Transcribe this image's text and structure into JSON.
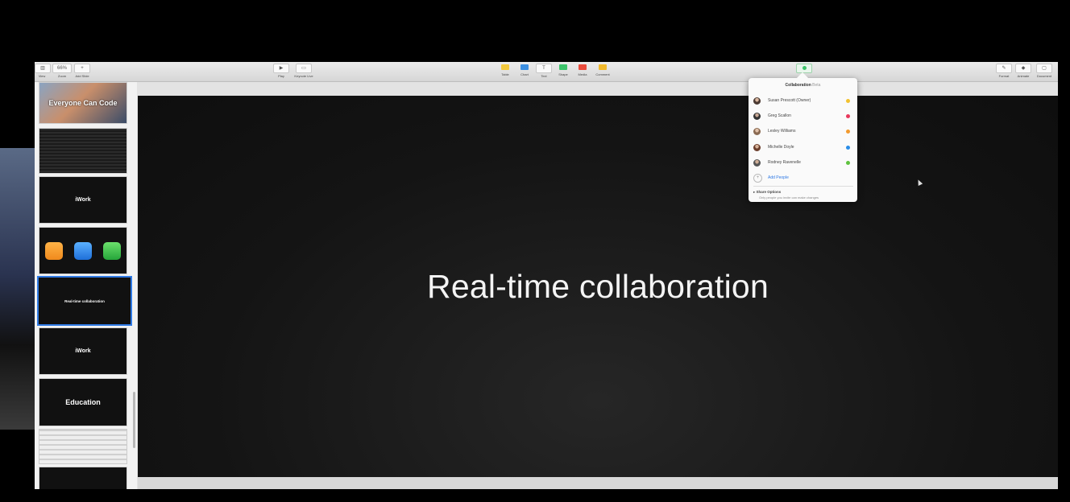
{
  "toolbar": {
    "left": [
      {
        "label": "View",
        "icon": "sidebar-icon"
      },
      {
        "label": "Zoom",
        "value": "66%",
        "icon": "zoom-icon"
      },
      {
        "label": "Add Slide",
        "icon": "plus-icon"
      }
    ],
    "center_left": [
      {
        "label": "Play",
        "icon": "play-icon"
      },
      {
        "label": "Keynote Live",
        "icon": "keynote-live-icon"
      }
    ],
    "insert": [
      {
        "label": "Table",
        "icon": "table-icon",
        "color": "#f3c93d"
      },
      {
        "label": "Chart",
        "icon": "chart-icon",
        "color": "#3b8ee0"
      },
      {
        "label": "Text",
        "icon": "text-icon",
        "color": "#888888"
      },
      {
        "label": "Shape",
        "icon": "shape-icon",
        "color": "#3cc46b"
      },
      {
        "label": "Media",
        "icon": "media-icon",
        "color": "#e94b3c"
      },
      {
        "label": "Comment",
        "icon": "comment-icon",
        "color": "#f1b92c"
      }
    ],
    "collaborate": {
      "icon": "collaborate-icon",
      "color": "#3cc46b"
    },
    "right": [
      {
        "label": "Format",
        "icon": "format-icon"
      },
      {
        "label": "Animate",
        "icon": "animate-icon"
      },
      {
        "label": "Document",
        "icon": "document-icon"
      }
    ]
  },
  "sidebar": {
    "slides": [
      {
        "label": "Everyone Can Code",
        "kind": "photo"
      },
      {
        "label": "",
        "kind": "text-grid"
      },
      {
        "label": "iWork",
        "kind": "title"
      },
      {
        "label": "",
        "kind": "app-icons"
      },
      {
        "label": "Real-time collaboration",
        "kind": "title",
        "selected": true
      },
      {
        "label": "iWork",
        "kind": "title"
      },
      {
        "label": "Education",
        "kind": "title"
      },
      {
        "label": "",
        "kind": "lines"
      },
      {
        "label": "",
        "kind": "dark"
      }
    ]
  },
  "slide": {
    "title": "Real-time collaboration"
  },
  "collaboration": {
    "title": "Collaboration",
    "beta": "Beta",
    "people": [
      {
        "name": "Susan Prescott (Owner)",
        "color": "#f2c12e"
      },
      {
        "name": "Greg Scallon",
        "color": "#e8385c"
      },
      {
        "name": "Lesley Williams",
        "color": "#f29a2e"
      },
      {
        "name": "Michelle Doyle",
        "color": "#2a8de8"
      },
      {
        "name": "Rodney Ravenelle",
        "color": "#5ec23e"
      }
    ],
    "add_people": "Add People",
    "share_options": "Share Options",
    "share_subtitle": "Only people you invite can make changes"
  }
}
